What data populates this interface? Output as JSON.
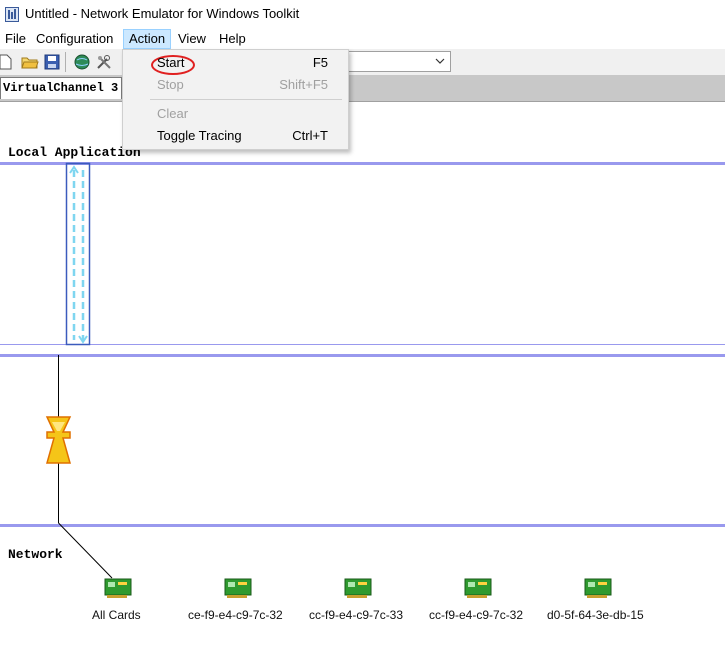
{
  "window": {
    "title": "Untitled - Network Emulator for Windows Toolkit"
  },
  "menubar": {
    "items": [
      "File",
      "Configuration",
      "Action",
      "View",
      "Help"
    ],
    "active": "Action"
  },
  "toolbar": {
    "icons": [
      "new-file-icon",
      "open-folder-icon",
      "save-icon",
      "globe-icon",
      "tools-icon"
    ],
    "combo_value": ""
  },
  "tabs": {
    "items": [
      "VirtualChannel 3"
    ]
  },
  "diagram": {
    "local_label": "Local Application",
    "network_label": "Network",
    "cards": [
      "All Cards",
      "ce-f9-e4-c9-7c-32",
      "cc-f9-e4-c9-7c-33",
      "cc-f9-e4-c9-7c-32",
      "d0-5f-64-3e-db-15"
    ]
  },
  "action_menu": {
    "items": [
      {
        "label": "Start",
        "shortcut": "F5",
        "enabled": true,
        "highlighted": true
      },
      {
        "label": "Stop",
        "shortcut": "Shift+F5",
        "enabled": false
      },
      {
        "label": "Clear",
        "shortcut": "",
        "enabled": false
      },
      {
        "label": "Toggle Tracing",
        "shortcut": "Ctrl+T",
        "enabled": true
      }
    ]
  },
  "colors": {
    "lane_line": "#9999ee",
    "link_box": "#3b5bbd",
    "link_arrow": "#7fd6f0",
    "highlight_circle": "#e02020",
    "filter_icon": "#f5c518"
  }
}
